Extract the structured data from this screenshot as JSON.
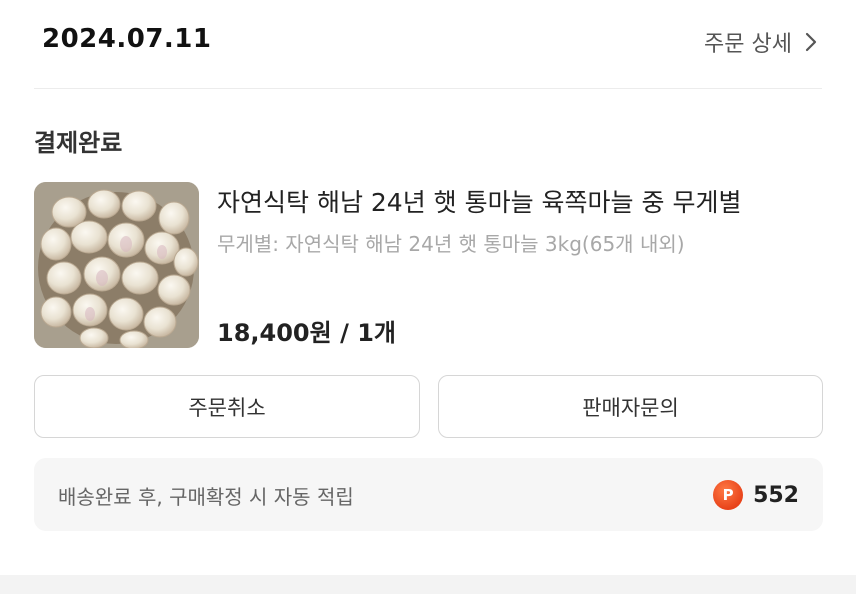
{
  "order": {
    "date": "2024.07.11",
    "detail_link_label": "주문 상세",
    "status": "결제완료"
  },
  "product": {
    "image_icon": "garlic-photo",
    "name": "자연식탁 해남 24년 햇 통마늘 육쪽마늘 중 무게별",
    "option": "무게별: 자연식탁 해남 24년 햇 통마늘 3kg(65개 내외)",
    "price": "18,400원",
    "separator": "/",
    "quantity": "1개"
  },
  "actions": {
    "cancel_label": "주문취소",
    "inquiry_label": "판매자문의"
  },
  "points": {
    "message": "배송완료 후, 구매확정 시 자동 적립",
    "icon_letter": "P",
    "icon_color": "#e8431a",
    "value": "552"
  }
}
